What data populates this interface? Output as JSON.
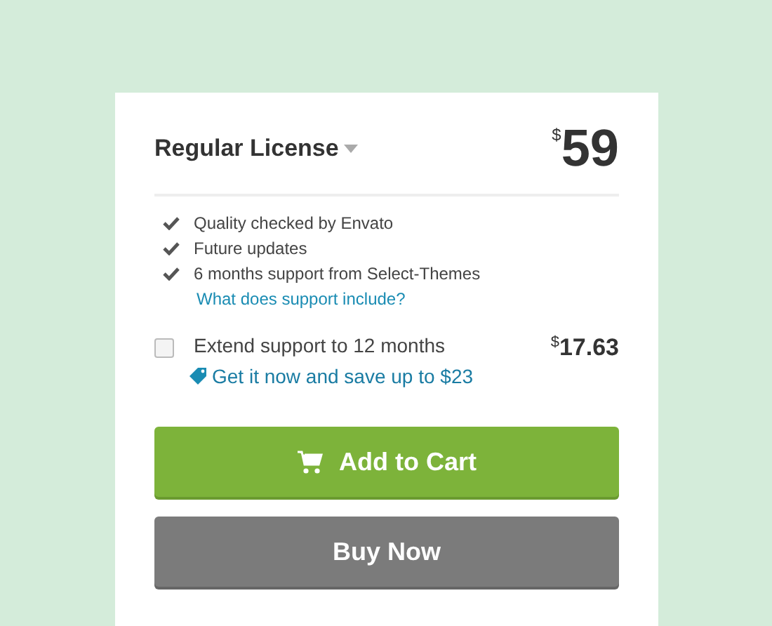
{
  "license": {
    "title": "Regular License",
    "currency": "$",
    "price": "59"
  },
  "features": [
    "Quality checked by Envato",
    "Future updates",
    "6 months support from Select-Themes"
  ],
  "support_link": "What does support include?",
  "extend": {
    "label": "Extend support to 12 months",
    "checked": false,
    "currency": "$",
    "price": "17.63",
    "offer": "Get it now and save up to $23"
  },
  "buttons": [
    {
      "kind": "cart",
      "label": "Add to Cart"
    },
    {
      "kind": "buy",
      "label": "Buy Now"
    }
  ]
}
